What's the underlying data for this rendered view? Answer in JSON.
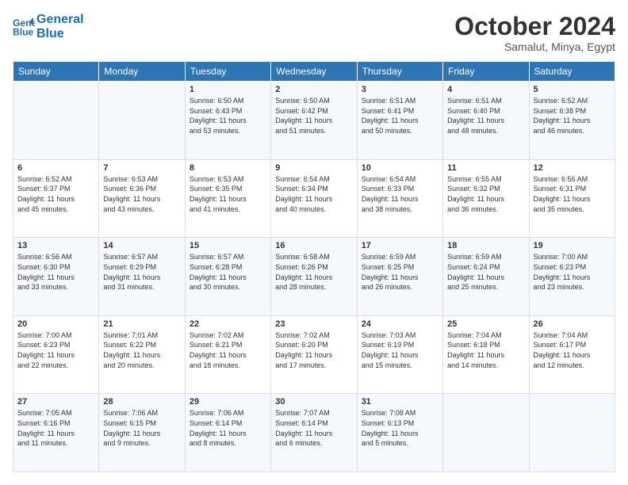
{
  "logo": {
    "line1": "General",
    "line2": "Blue"
  },
  "header": {
    "month": "October 2024",
    "location": "Samalut, Minya, Egypt"
  },
  "days_of_week": [
    "Sunday",
    "Monday",
    "Tuesday",
    "Wednesday",
    "Thursday",
    "Friday",
    "Saturday"
  ],
  "weeks": [
    [
      {
        "day": "",
        "info": ""
      },
      {
        "day": "",
        "info": ""
      },
      {
        "day": "1",
        "info": "Sunrise: 6:50 AM\nSunset: 6:43 PM\nDaylight: 11 hours\nand 53 minutes."
      },
      {
        "day": "2",
        "info": "Sunrise: 6:50 AM\nSunset: 6:42 PM\nDaylight: 11 hours\nand 51 minutes."
      },
      {
        "day": "3",
        "info": "Sunrise: 6:51 AM\nSunset: 6:41 PM\nDaylight: 11 hours\nand 50 minutes."
      },
      {
        "day": "4",
        "info": "Sunrise: 6:51 AM\nSunset: 6:40 PM\nDaylight: 11 hours\nand 48 minutes."
      },
      {
        "day": "5",
        "info": "Sunrise: 6:52 AM\nSunset: 6:38 PM\nDaylight: 11 hours\nand 46 minutes."
      }
    ],
    [
      {
        "day": "6",
        "info": "Sunrise: 6:52 AM\nSunset: 6:37 PM\nDaylight: 11 hours\nand 45 minutes."
      },
      {
        "day": "7",
        "info": "Sunrise: 6:53 AM\nSunset: 6:36 PM\nDaylight: 11 hours\nand 43 minutes."
      },
      {
        "day": "8",
        "info": "Sunrise: 6:53 AM\nSunset: 6:35 PM\nDaylight: 11 hours\nand 41 minutes."
      },
      {
        "day": "9",
        "info": "Sunrise: 6:54 AM\nSunset: 6:34 PM\nDaylight: 11 hours\nand 40 minutes."
      },
      {
        "day": "10",
        "info": "Sunrise: 6:54 AM\nSunset: 6:33 PM\nDaylight: 11 hours\nand 38 minutes."
      },
      {
        "day": "11",
        "info": "Sunrise: 6:55 AM\nSunset: 6:32 PM\nDaylight: 11 hours\nand 36 minutes."
      },
      {
        "day": "12",
        "info": "Sunrise: 6:56 AM\nSunset: 6:31 PM\nDaylight: 11 hours\nand 35 minutes."
      }
    ],
    [
      {
        "day": "13",
        "info": "Sunrise: 6:56 AM\nSunset: 6:30 PM\nDaylight: 11 hours\nand 33 minutes."
      },
      {
        "day": "14",
        "info": "Sunrise: 6:57 AM\nSunset: 6:29 PM\nDaylight: 11 hours\nand 31 minutes."
      },
      {
        "day": "15",
        "info": "Sunrise: 6:57 AM\nSunset: 6:28 PM\nDaylight: 11 hours\nand 30 minutes."
      },
      {
        "day": "16",
        "info": "Sunrise: 6:58 AM\nSunset: 6:26 PM\nDaylight: 11 hours\nand 28 minutes."
      },
      {
        "day": "17",
        "info": "Sunrise: 6:59 AM\nSunset: 6:25 PM\nDaylight: 11 hours\nand 26 minutes."
      },
      {
        "day": "18",
        "info": "Sunrise: 6:59 AM\nSunset: 6:24 PM\nDaylight: 11 hours\nand 25 minutes."
      },
      {
        "day": "19",
        "info": "Sunrise: 7:00 AM\nSunset: 6:23 PM\nDaylight: 11 hours\nand 23 minutes."
      }
    ],
    [
      {
        "day": "20",
        "info": "Sunrise: 7:00 AM\nSunset: 6:23 PM\nDaylight: 11 hours\nand 22 minutes."
      },
      {
        "day": "21",
        "info": "Sunrise: 7:01 AM\nSunset: 6:22 PM\nDaylight: 11 hours\nand 20 minutes."
      },
      {
        "day": "22",
        "info": "Sunrise: 7:02 AM\nSunset: 6:21 PM\nDaylight: 11 hours\nand 18 minutes."
      },
      {
        "day": "23",
        "info": "Sunrise: 7:02 AM\nSunset: 6:20 PM\nDaylight: 11 hours\nand 17 minutes."
      },
      {
        "day": "24",
        "info": "Sunrise: 7:03 AM\nSunset: 6:19 PM\nDaylight: 11 hours\nand 15 minutes."
      },
      {
        "day": "25",
        "info": "Sunrise: 7:04 AM\nSunset: 6:18 PM\nDaylight: 11 hours\nand 14 minutes."
      },
      {
        "day": "26",
        "info": "Sunrise: 7:04 AM\nSunset: 6:17 PM\nDaylight: 11 hours\nand 12 minutes."
      }
    ],
    [
      {
        "day": "27",
        "info": "Sunrise: 7:05 AM\nSunset: 6:16 PM\nDaylight: 11 hours\nand 11 minutes."
      },
      {
        "day": "28",
        "info": "Sunrise: 7:06 AM\nSunset: 6:15 PM\nDaylight: 11 hours\nand 9 minutes."
      },
      {
        "day": "29",
        "info": "Sunrise: 7:06 AM\nSunset: 6:14 PM\nDaylight: 11 hours\nand 8 minutes."
      },
      {
        "day": "30",
        "info": "Sunrise: 7:07 AM\nSunset: 6:14 PM\nDaylight: 11 hours\nand 6 minutes."
      },
      {
        "day": "31",
        "info": "Sunrise: 7:08 AM\nSunset: 6:13 PM\nDaylight: 11 hours\nand 5 minutes."
      },
      {
        "day": "",
        "info": ""
      },
      {
        "day": "",
        "info": ""
      }
    ]
  ]
}
